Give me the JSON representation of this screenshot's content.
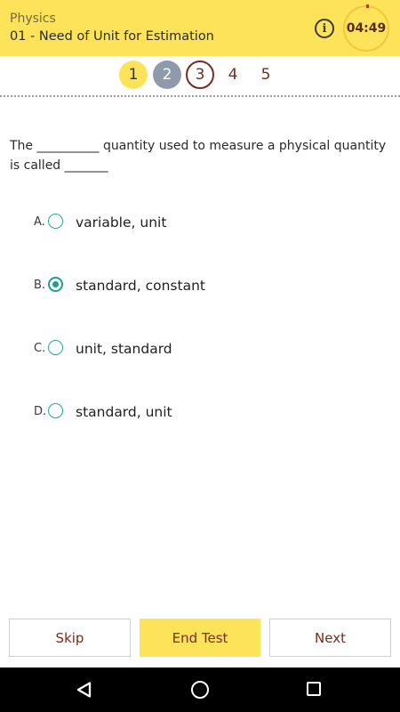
{
  "header": {
    "subject": "Physics",
    "chapter": "01 - Need of Unit for Estimation",
    "info_icon": "info-icon",
    "timer": "04:49"
  },
  "question_nav": {
    "numbers": [
      "1",
      "2",
      "3",
      "4",
      "5"
    ],
    "current": 3
  },
  "question": {
    "text": "The __________ quantity used to measure a physical quantity is called _______"
  },
  "options": [
    {
      "letter": "A.",
      "text": "variable, unit",
      "selected": false
    },
    {
      "letter": "B.",
      "text": "standard, constant",
      "selected": true
    },
    {
      "letter": "C.",
      "text": "unit, standard",
      "selected": false
    },
    {
      "letter": "D.",
      "text": "standard, unit",
      "selected": false
    }
  ],
  "buttons": {
    "skip": "Skip",
    "end_test": "End Test",
    "next": "Next"
  },
  "colors": {
    "header_bg": "#fce35a",
    "accent_teal": "#1e9e90",
    "text_maroon": "#7a2a1c",
    "answered_gray": "#8f9bad"
  }
}
